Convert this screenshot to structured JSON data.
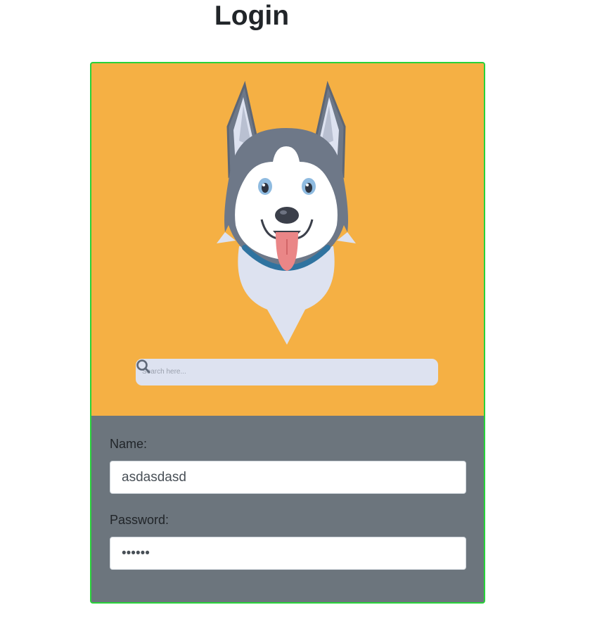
{
  "page": {
    "title": "Login"
  },
  "hero": {
    "search": {
      "placeholder": "Search here...",
      "icon": "search-icon"
    },
    "colors": {
      "background": "#f5b044",
      "card_border": "#28d23a"
    }
  },
  "form": {
    "name_label": "Name:",
    "name_value": "asdasdasd",
    "password_label": "Password:",
    "password_value": "asdasd",
    "background": "#6c757d"
  }
}
